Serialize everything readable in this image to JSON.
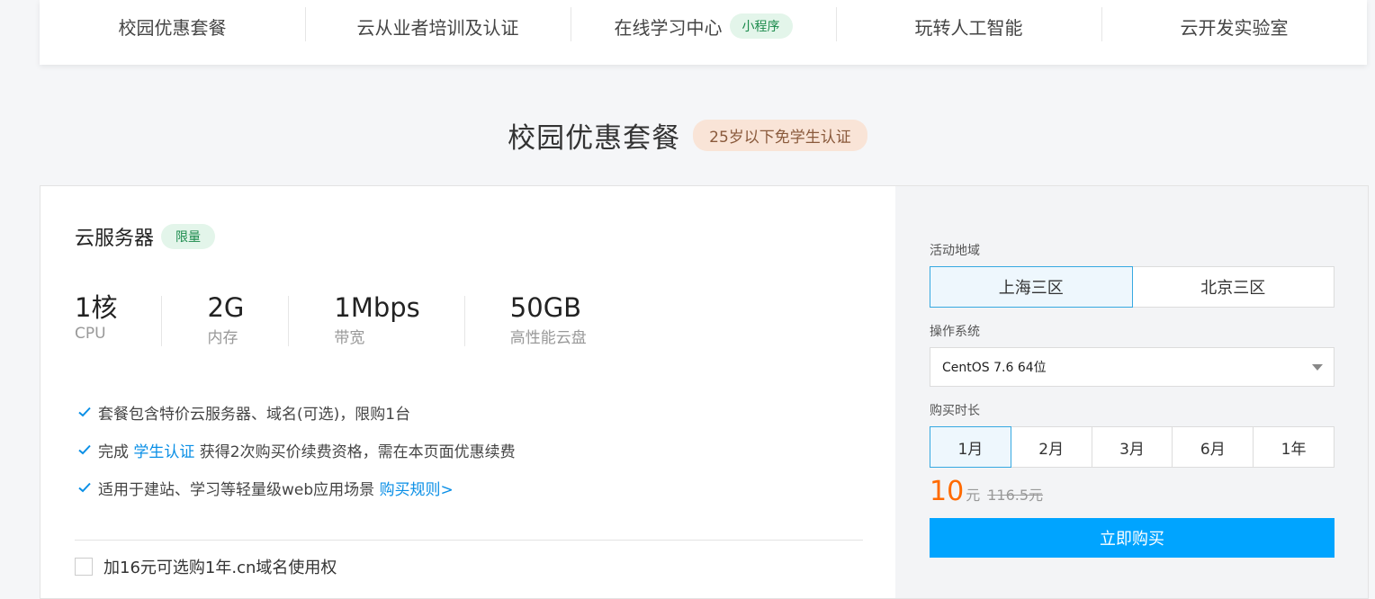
{
  "nav": {
    "items": [
      {
        "label": "校园优惠套餐"
      },
      {
        "label": "云从业者培训及认证"
      },
      {
        "label": "在线学习中心",
        "badge": "小程序"
      },
      {
        "label": "玩转人工智能"
      },
      {
        "label": "云开发实验室"
      }
    ]
  },
  "section": {
    "title": "校园优惠套餐",
    "badge": "25岁以下免学生认证"
  },
  "product": {
    "name": "云服务器",
    "badge": "限量",
    "specs": [
      {
        "value": "1核",
        "label": "CPU"
      },
      {
        "value": "2G",
        "label": "内存"
      },
      {
        "value": "1Mbps",
        "label": "带宽"
      },
      {
        "value": "50GB",
        "label": "高性能云盘"
      }
    ],
    "features": [
      {
        "text": "套餐包含特价云服务器、域名(可选)，限购1台"
      },
      {
        "prefix": "完成 ",
        "link": "学生认证",
        "suffix": " 获得2次购买价续费资格，需在本页面优惠续费"
      },
      {
        "prefix": "适用于建站、学习等轻量级web应用场景 ",
        "link": "购买规则>"
      }
    ],
    "addon": "加16元可选购1年.cn域名使用权"
  },
  "order": {
    "region_label": "活动地域",
    "regions": [
      "上海三区",
      "北京三区"
    ],
    "os_label": "操作系统",
    "os_value": "CentOS 7.6 64位",
    "duration_label": "购买时长",
    "durations": [
      "1月",
      "2月",
      "3月",
      "6月",
      "1年"
    ],
    "price_now": "10",
    "price_unit": "元",
    "price_orig": "116.5元",
    "buy_label": "立即购买"
  },
  "colors": {
    "accent": "#00a4ff",
    "price": "#ff6a00",
    "link": "#0a8fe6",
    "check": "#0a8fe6"
  },
  "icons": {
    "feature_check": "check-icon",
    "os_dropdown": "caret-down-icon"
  }
}
